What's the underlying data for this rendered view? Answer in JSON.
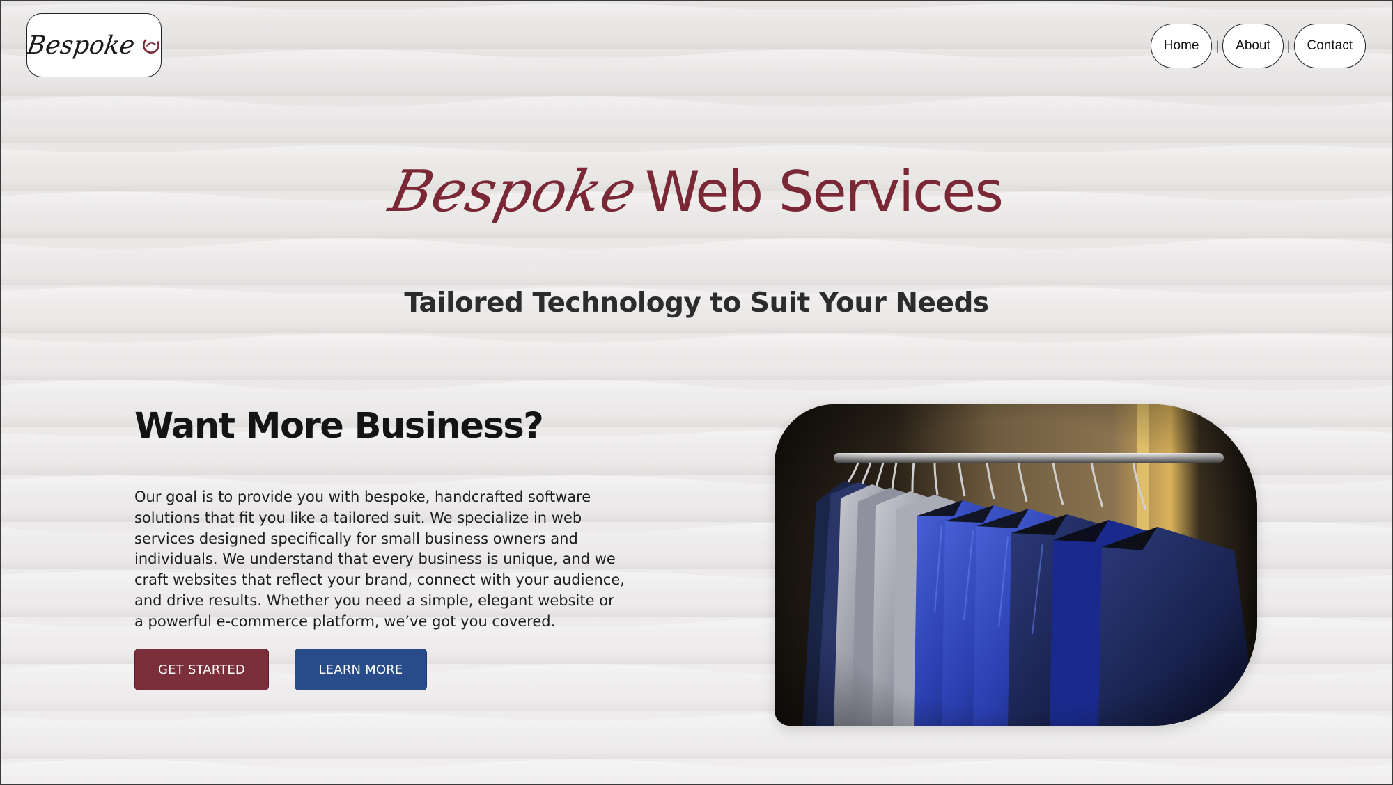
{
  "brand": {
    "logo_text": "Bespoke",
    "accent_color": "#7a2836"
  },
  "nav": {
    "items": [
      {
        "label": "Home"
      },
      {
        "label": "About"
      },
      {
        "label": "Contact"
      }
    ],
    "separator": "|"
  },
  "hero": {
    "title_script": "Bespoke",
    "title_rest": "Web Services",
    "tagline": "Tailored Technology to Suit Your Needs"
  },
  "intro": {
    "heading": "Want More Business?",
    "body": "Our goal is to provide you with bespoke, handcrafted software solutions that fit you like a tailored suit. We specialize in web services designed specifically for small business owners and individuals. We understand that every business is unique, and we craft websites that reflect your brand, connect with your audience, and drive results. Whether you need a simple, elegant website or a powerful e-commerce platform, we’ve got you covered.",
    "buttons": {
      "get_started": "GET STARTED",
      "learn_more": "LEARN MORE"
    },
    "button_colors": {
      "get_started": "#7a2f3a",
      "learn_more": "#284b8a"
    }
  },
  "image": {
    "subject": "suits-on-rack-photo"
  }
}
